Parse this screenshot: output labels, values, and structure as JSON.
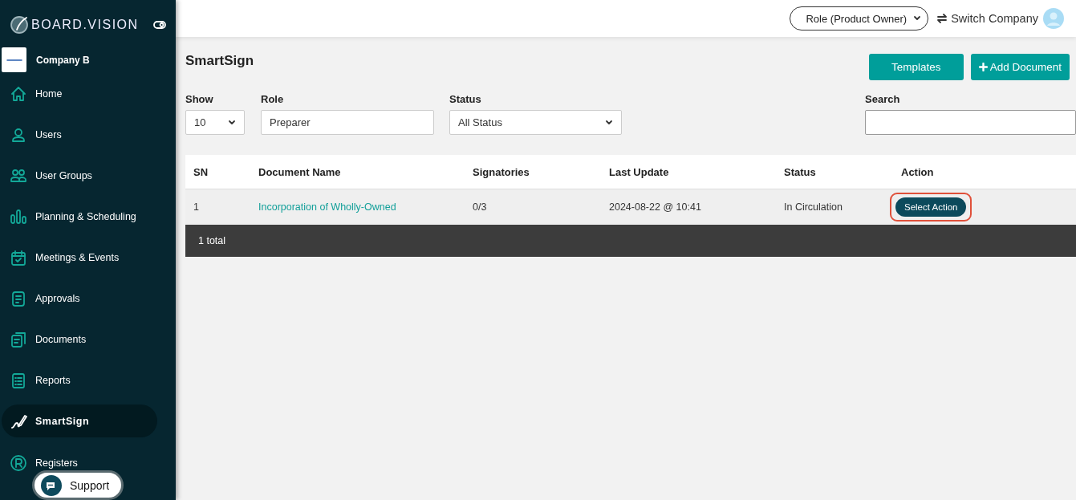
{
  "brand": {
    "name": "BOARD.VISION"
  },
  "company": {
    "name": "Company B"
  },
  "sidebar": {
    "items": [
      {
        "label": "Home",
        "selected": false
      },
      {
        "label": "Users",
        "selected": false
      },
      {
        "label": "User Groups",
        "selected": false
      },
      {
        "label": "Planning & Scheduling",
        "selected": false
      },
      {
        "label": "Meetings & Events",
        "selected": false
      },
      {
        "label": "Approvals",
        "selected": false
      },
      {
        "label": "Documents",
        "selected": false
      },
      {
        "label": "Reports",
        "selected": false
      },
      {
        "label": "SmartSign",
        "selected": true
      },
      {
        "label": "Registers",
        "selected": false
      }
    ]
  },
  "support": {
    "label": "Support"
  },
  "topbar": {
    "role": "Role (Product Owner)",
    "switch": "Switch Company"
  },
  "page": {
    "title": "SmartSign",
    "buttons": [
      {
        "label": "Templates",
        "kind": "plain"
      },
      {
        "label": "Add Document",
        "kind": "add"
      }
    ]
  },
  "filters": {
    "show": {
      "label": "Show",
      "value": "10"
    },
    "role": {
      "label": "Role",
      "value": "Preparer"
    },
    "status": {
      "label": "Status",
      "value": "All Status"
    },
    "search": {
      "label": "Search"
    }
  },
  "table": {
    "columns": [
      "SN",
      "Document Name",
      "Signatories",
      "Last Update",
      "Status",
      "Action"
    ],
    "rows": [
      {
        "sn": "1",
        "name": "Incorporation of Wholly-Owned",
        "signatories": "0/3",
        "updated": "2024-08-22 @ 10:41",
        "status": "In Circulation",
        "action": "Select Action",
        "highlighted": true
      }
    ],
    "total": "1 total"
  }
}
